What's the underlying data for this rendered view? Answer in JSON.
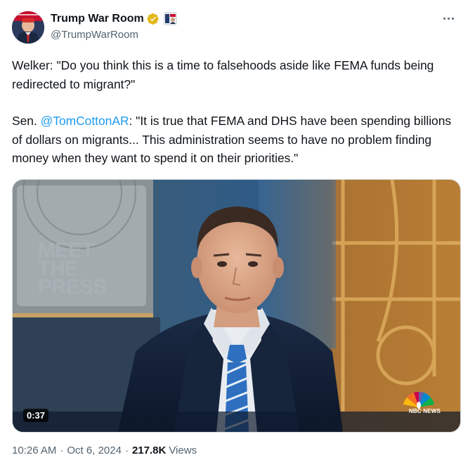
{
  "author": {
    "display_name": "Trump War Room",
    "handle": "@TrumpWarRoom"
  },
  "tweet": {
    "line1": "Welker: \"Do you think this is a time to falsehoods aside like FEMA funds being redirected to migrant?\"",
    "line2_prefix": "Sen. ",
    "mention": "@TomCottonAR",
    "line2_rest": ": \"It is true that FEMA and DHS have been spending billions of dollars on migrants... This administration seems to have no problem finding money when they want to spend it on their priorities.\""
  },
  "media": {
    "duration": "0:37",
    "sign_text": "MEET THE PRESS",
    "network_logo_text": "NBC NEWS"
  },
  "meta": {
    "time": "10:26 AM",
    "date": "Oct 6, 2024",
    "separator": "·",
    "views_count": "217.8K",
    "views_label": "Views"
  },
  "colors": {
    "accent": "#1d9bf0",
    "verified_badge": "#e2b719",
    "text_primary": "#0f1419",
    "text_secondary": "#536471"
  },
  "icons": {
    "verified": "verified-badge-icon",
    "affiliate": "affiliate-badge-icon",
    "more": "more-options-icon"
  }
}
